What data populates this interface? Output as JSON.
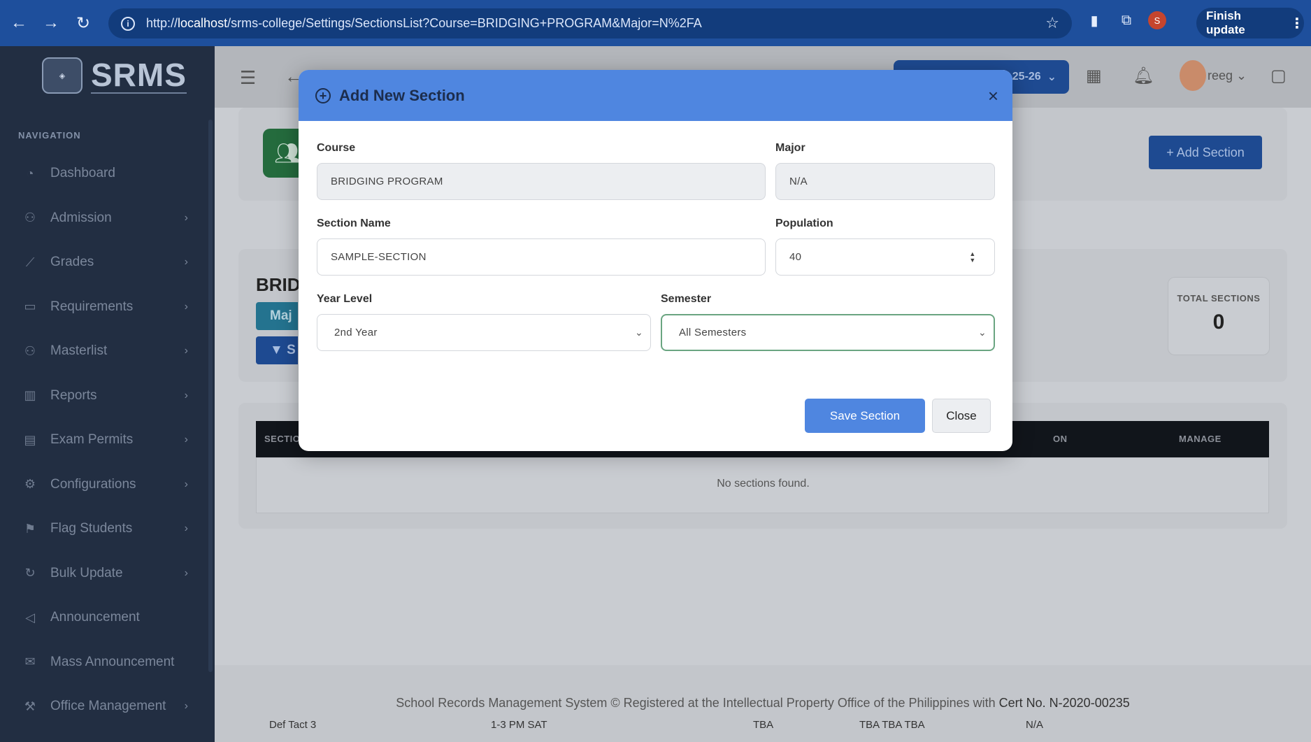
{
  "browser": {
    "url_prefix": "http://",
    "url_host": "localhost",
    "url_path": "/srms-college/Settings/SectionsList?Course=BRIDGING+PROGRAM&Major=N%2FA",
    "profile_initial": "S",
    "finish_update_label": "Finish update"
  },
  "sidebar": {
    "brand": "SRMS",
    "nav_heading": "NAVIGATION",
    "items": [
      {
        "label": "Dashboard",
        "icon": "gauge-icon",
        "has_submenu": false
      },
      {
        "label": "Admission",
        "icon": "user-plus-icon",
        "has_submenu": true
      },
      {
        "label": "Grades",
        "icon": "chart-line-icon",
        "has_submenu": true
      },
      {
        "label": "Requirements",
        "icon": "folder-icon",
        "has_submenu": true
      },
      {
        "label": "Masterlist",
        "icon": "users-icon",
        "has_submenu": true
      },
      {
        "label": "Reports",
        "icon": "bar-chart-icon",
        "has_submenu": true
      },
      {
        "label": "Exam Permits",
        "icon": "id-card-icon",
        "has_submenu": true
      },
      {
        "label": "Configurations",
        "icon": "gear-icon",
        "has_submenu": true
      },
      {
        "label": "Flag Students",
        "icon": "flag-icon",
        "has_submenu": true
      },
      {
        "label": "Bulk Update",
        "icon": "refresh-icon",
        "has_submenu": true
      },
      {
        "label": "Announcement",
        "icon": "megaphone-icon",
        "has_submenu": false
      },
      {
        "label": "Mass Announcement",
        "icon": "envelope-icon",
        "has_submenu": false
      },
      {
        "label": "Office Management",
        "icon": "wrench-icon",
        "has_submenu": true
      }
    ]
  },
  "topbar": {
    "year_label": "25-26",
    "user_name": "reeg"
  },
  "page": {
    "add_section_label": "+ Add Section",
    "course_heading_partial": "BRID",
    "major_chip_partial": "Maj",
    "filter_chip_partial": "S",
    "total_sections_label": "TOTAL SECTIONS",
    "total_sections_value": "0",
    "table_headers": {
      "section_partial": "SECTIO",
      "col_partial": "ON",
      "manage": "MANAGE"
    },
    "empty_message": "No sections found.",
    "footer_text": "School Records Management System © Registered at the Intellectual Property Office of the Philippines with",
    "footer_cert": "Cert No. N-2020-00235",
    "ghost_row": [
      "Def Tact 3",
      "1-3 PM SAT",
      "TBA",
      "TBA TBA TBA",
      "N/A"
    ]
  },
  "modal": {
    "title": "Add New Section",
    "close_symbol": "×",
    "course_label": "Course",
    "course_value": "BRIDGING PROGRAM",
    "major_label": "Major",
    "major_value": "N/A",
    "section_name_label": "Section Name",
    "section_name_value": "SAMPLE-SECTION",
    "population_label": "Population",
    "population_value": "40",
    "year_level_label": "Year Level",
    "year_level_value": "2nd Year",
    "semester_label": "Semester",
    "semester_value": "All Semesters",
    "save_label": "Save Section",
    "close_label": "Close"
  },
  "colors": {
    "modal_header": "#4f86e0",
    "sidebar": "#222e42",
    "browser_bar": "#1e4f9c",
    "focused_border": "#6aa581"
  }
}
